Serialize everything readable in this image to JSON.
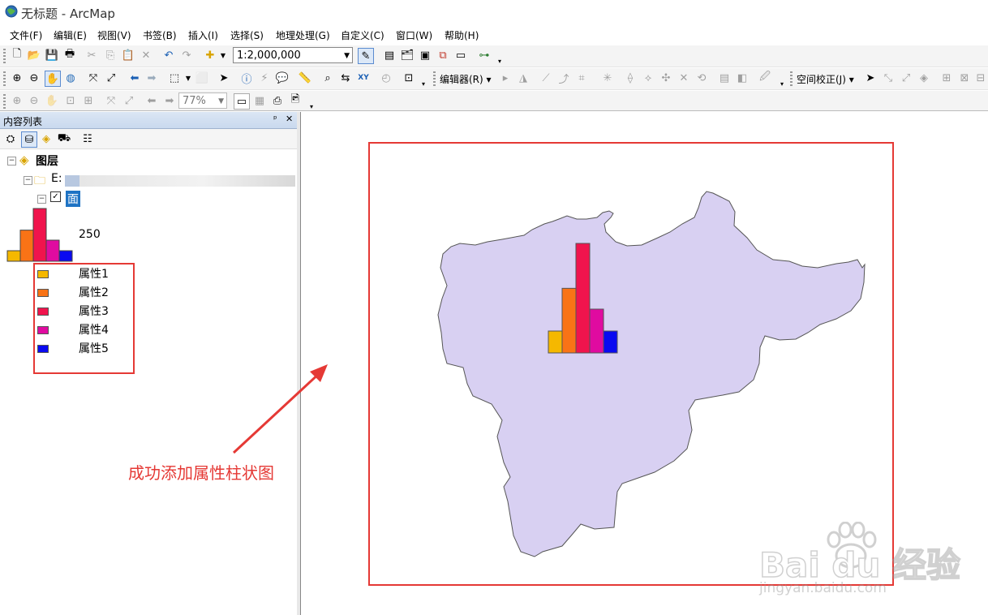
{
  "window": {
    "title": "无标题 - ArcMap"
  },
  "menu": [
    "文件(F)",
    "编辑(E)",
    "视图(V)",
    "书签(B)",
    "插入(I)",
    "选择(S)",
    "地理处理(G)",
    "自定义(C)",
    "窗口(W)",
    "帮助(H)"
  ],
  "toolbar": {
    "scale_value": "1:2,000,000",
    "editor_label": "编辑器(R)",
    "spatial_adjust_label": "空间校正(J)",
    "zoom_value": "77%"
  },
  "toc": {
    "title": "内容列表",
    "pin_glyph": "ᵖ",
    "close_glyph": "✕",
    "root_label": "图层",
    "folder_label": "E:",
    "layer_name": "面",
    "chart_value_label": "250",
    "legend_items": [
      {
        "label": "属性1",
        "color": "#f5b800"
      },
      {
        "label": "属性2",
        "color": "#f97316"
      },
      {
        "label": "属性3",
        "color": "#f0144d"
      },
      {
        "label": "属性4",
        "color": "#e00ba0"
      },
      {
        "label": "属性5",
        "color": "#0a0af0"
      }
    ]
  },
  "map": {
    "polygon_color": "#d8d0f2",
    "chart_relative_values": [
      0.2,
      0.59,
      1.0,
      0.4,
      0.2
    ]
  },
  "annotation": {
    "text": "成功添加属性柱状图",
    "color": "#e53935"
  },
  "watermark": {
    "brand": "Bai du 经验",
    "url": "jingyan.baidu.com"
  }
}
